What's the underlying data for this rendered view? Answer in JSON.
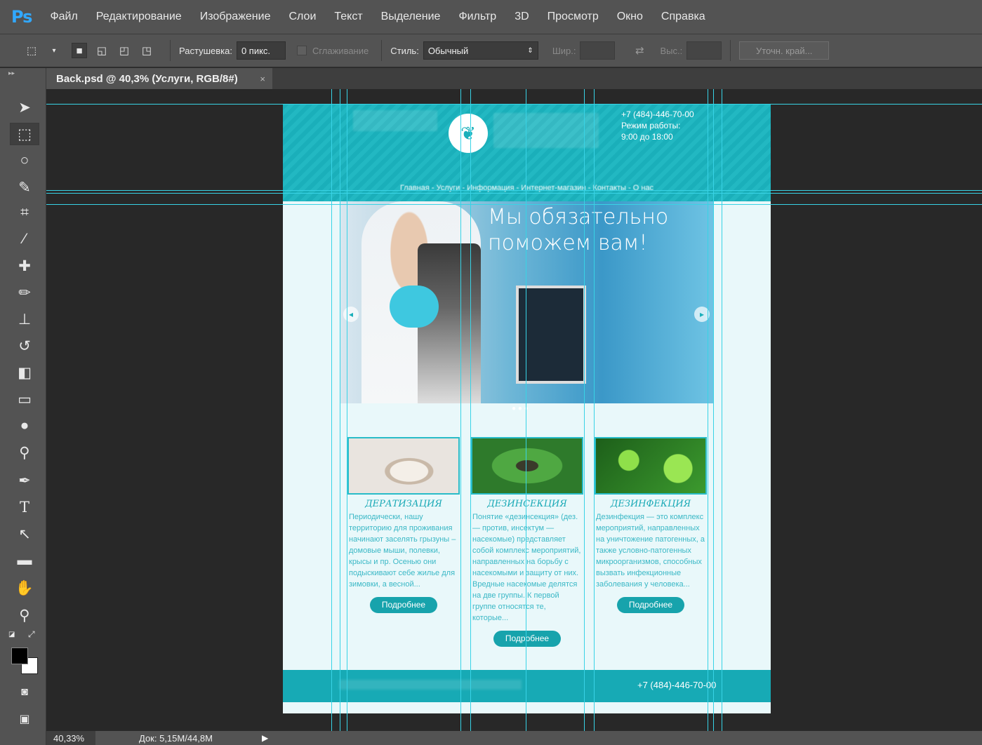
{
  "app": {
    "logo": "Ps"
  },
  "menu": [
    "Файл",
    "Редактирование",
    "Изображение",
    "Слои",
    "Текст",
    "Выделение",
    "Фильтр",
    "3D",
    "Просмотр",
    "Окно",
    "Справка"
  ],
  "options": {
    "feather_label": "Растушевка:",
    "feather_value": "0 пикс.",
    "antialias_label": "Сглаживание",
    "style_label": "Стиль:",
    "style_value": "Обычный",
    "width_label": "Шир.:",
    "height_label": "Выс.:",
    "refine_button": "Уточн. край..."
  },
  "tab": {
    "title": "Back.psd @ 40,3% (Услуги, RGB/8#)",
    "close": "×"
  },
  "tools": [
    "move-tool",
    "rectangular-marquee-tool",
    "lasso-tool",
    "quick-selection-tool",
    "crop-tool",
    "eyedropper-tool",
    "healing-brush-tool",
    "brush-tool",
    "clone-stamp-tool",
    "history-brush-tool",
    "eraser-tool",
    "gradient-tool",
    "blur-tool",
    "dodge-tool",
    "pen-tool",
    "type-tool",
    "path-selection-tool",
    "rectangle-tool",
    "hand-tool",
    "zoom-tool"
  ],
  "tool_glyphs": {
    "type": "T"
  },
  "status": {
    "zoom": "40,33%",
    "doc": "Док: 5,15M/44,8M"
  },
  "page": {
    "contact_phone": "+7 (484)-446-70-00",
    "contact_hours_label": "Режим работы:",
    "contact_hours": "9:00 до 18:00",
    "nav": "Главная - Услуги - Информация - Интернет-магазин - Контакты - О нас",
    "hero_title_1": "Мы обязательно",
    "hero_title_2": "поможем вам!",
    "cards": [
      {
        "title": "ДЕРАТИЗАЦИЯ",
        "text": "Периодически, нашу территорию для проживания начинают заселять грызуны – домовые мыши, полевки, крысы и пр. Осенью они подыскивают себе жилье для зимовки, а весной...",
        "button": "Подробнее"
      },
      {
        "title": "ДЕЗИНСЕКЦИЯ",
        "text": "Понятие «дезинсекция» (дез. — против, инсектум — насекомые) представляет собой комплекс мероприятий, направленных на борьбу с насекомыми и защиту от них. Вредные насекомые делятся на две группы. К первой группе относятся те, которые...",
        "button": "Подробнее"
      },
      {
        "title": "ДЕЗИНФЕКЦИЯ",
        "text": "Дезинфекция — это комплекс мероприятий, направленных на уничтожение патогенных, а также условно-патогенных микроорганизмов, способных вызвать инфекционные заболевания у человека...",
        "button": "Подробнее"
      }
    ],
    "footer_phone": "+7 (484)-446-70-00"
  },
  "colors": {
    "accent": "#1aafba",
    "guide": "#38d3e6",
    "ps_blue": "#31a8ff"
  }
}
